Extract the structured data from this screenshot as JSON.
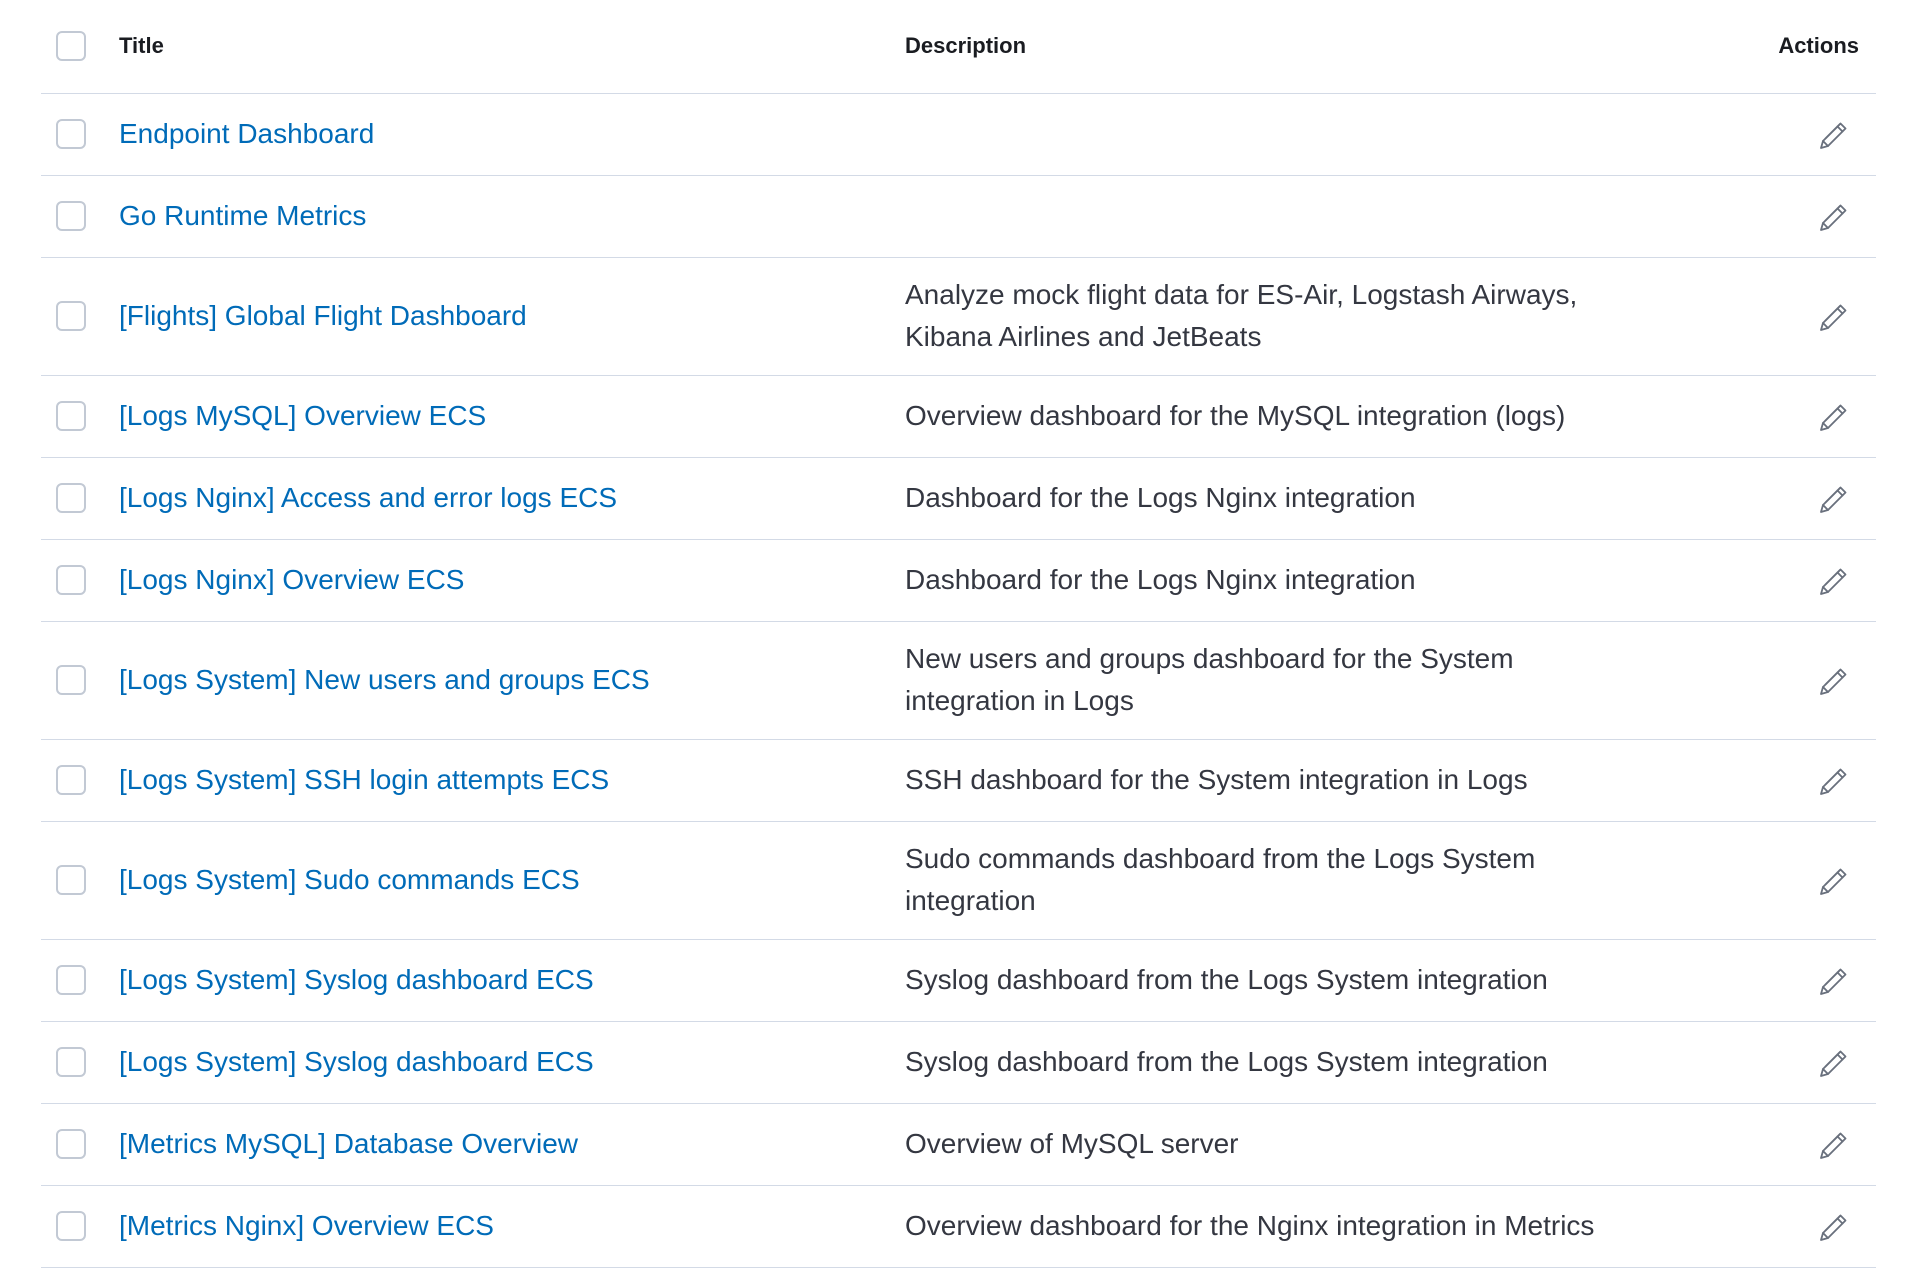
{
  "table": {
    "headers": {
      "title": "Title",
      "description": "Description",
      "actions": "Actions"
    },
    "rows": [
      {
        "title": "Endpoint Dashboard",
        "description": ""
      },
      {
        "title": "Go Runtime Metrics",
        "description": ""
      },
      {
        "title": "[Flights] Global Flight Dashboard",
        "description": "Analyze mock flight data for ES-Air, Logstash Airways, Kibana Airlines and JetBeats"
      },
      {
        "title": "[Logs MySQL] Overview ECS",
        "description": "Overview dashboard for the MySQL integration (logs)"
      },
      {
        "title": "[Logs Nginx] Access and error logs ECS",
        "description": "Dashboard for the Logs Nginx integration"
      },
      {
        "title": "[Logs Nginx] Overview ECS",
        "description": "Dashboard for the Logs Nginx integration"
      },
      {
        "title": "[Logs System] New users and groups ECS",
        "description": "New users and groups dashboard for the System integration in Logs"
      },
      {
        "title": "[Logs System] SSH login attempts ECS",
        "description": "SSH dashboard for the System integration in Logs"
      },
      {
        "title": "[Logs System] Sudo commands ECS",
        "description": "Sudo commands dashboard from the Logs System integration"
      },
      {
        "title": "[Logs System] Syslog dashboard ECS",
        "description": "Syslog dashboard from the Logs System integration"
      },
      {
        "title": "[Logs System] Syslog dashboard ECS",
        "description": "Syslog dashboard from the Logs System integration"
      },
      {
        "title": "[Metrics MySQL] Database Overview",
        "description": "Overview of MySQL server"
      },
      {
        "title": "[Metrics Nginx] Overview ECS",
        "description": "Overview dashboard for the Nginx integration in Metrics"
      }
    ]
  },
  "icons": {
    "edit": "pencil-icon"
  },
  "colors": {
    "link": "#006bb8",
    "border": "#d3dae6",
    "text": "#343741"
  }
}
